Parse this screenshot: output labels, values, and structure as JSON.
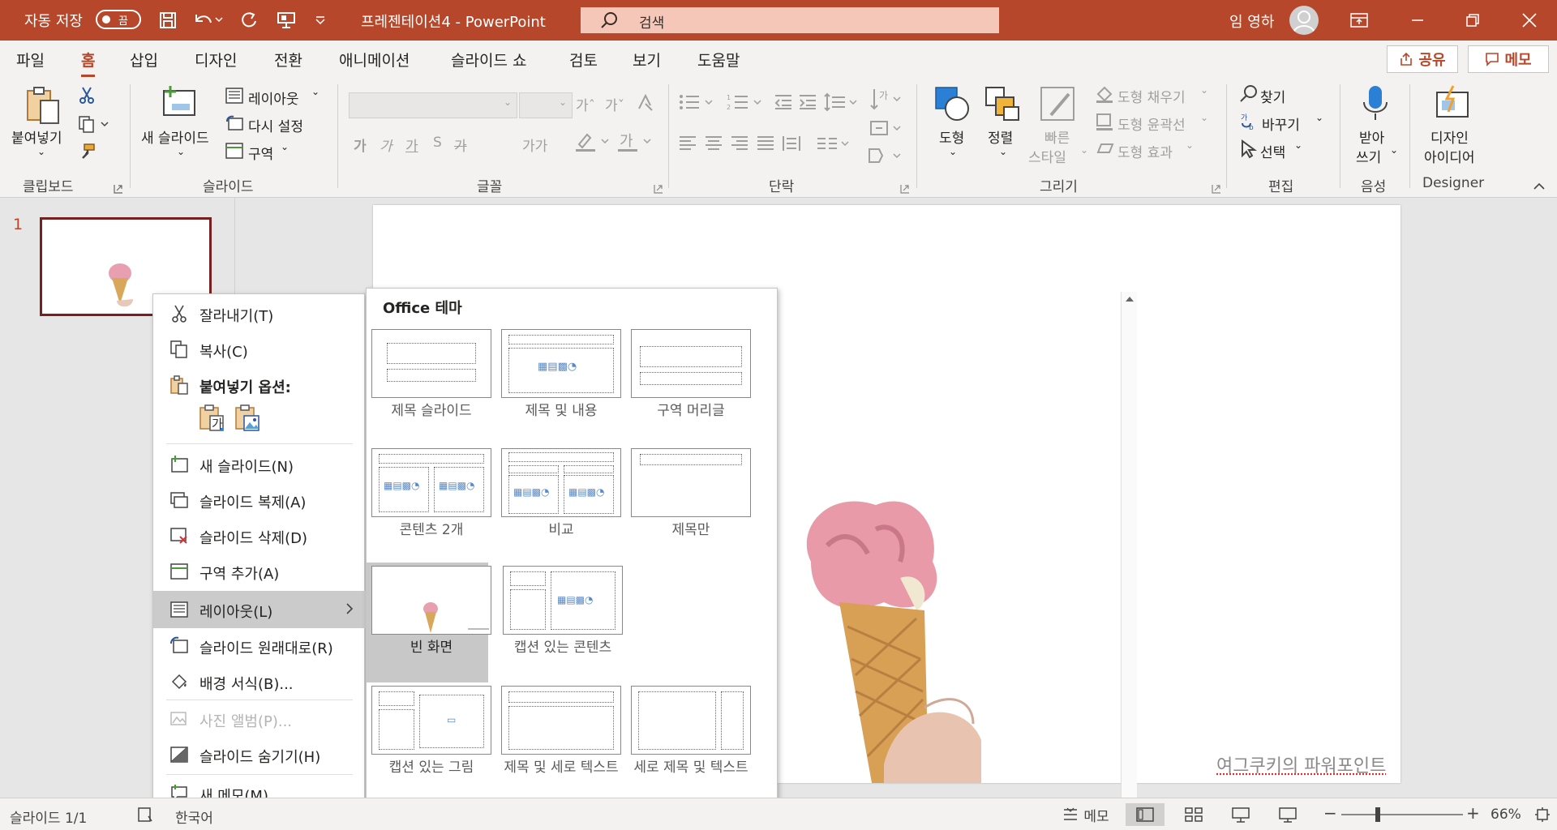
{
  "titlebar": {
    "autosave_label": "자동 저장",
    "autosave_state": "끔",
    "document_title": "프레젠테이션4  -  PowerPoint",
    "search_placeholder": "검색",
    "user_name": "임 영하",
    "bg_color": "#b7472a"
  },
  "tabs": [
    "파일",
    "홈",
    "삽입",
    "디자인",
    "전환",
    "애니메이션",
    "슬라이드 쇼",
    "검토",
    "보기",
    "도움말"
  ],
  "active_tab": "홈",
  "share_label": "공유",
  "memo_label": "메모",
  "ribbon": {
    "clipboard": {
      "paste": "붙여넣기",
      "group": "클립보드"
    },
    "slides": {
      "new_slide": "새 슬라이드",
      "layout": "레이아웃",
      "reset": "다시 설정",
      "section": "구역",
      "group": "슬라이드"
    },
    "font": {
      "group": "글꼴",
      "buttons": [
        "가",
        "가",
        "가",
        "S",
        "가",
        "가가"
      ]
    },
    "paragraph": {
      "group": "단락"
    },
    "drawing": {
      "shape": "도형",
      "arrange": "정렬",
      "quick_style_1": "빠른",
      "quick_style_2": "스타일",
      "fill": "도형 채우기",
      "outline": "도형 윤곽선",
      "effects": "도형 효과",
      "group": "그리기"
    },
    "editing": {
      "find": "찾기",
      "replace": "바꾸기",
      "select": "선택",
      "group": "편집"
    },
    "voice": {
      "dictate_1": "받아",
      "dictate_2": "쓰기",
      "group": "음성"
    },
    "designer": {
      "ideas_1": "디자인",
      "ideas_2": "아이디어",
      "group": "Designer"
    }
  },
  "thumbnail": {
    "number": "1"
  },
  "context_menu": [
    {
      "label": "잘라내기(T)",
      "icon": "scissors-icon"
    },
    {
      "label": "복사(C)",
      "icon": "copy-icon"
    },
    {
      "label": "붙여넣기 옵션:",
      "icon": "paste-icon"
    },
    {
      "label": "새 슬라이드(N)",
      "icon": "new-slide-icon"
    },
    {
      "label": "슬라이드 복제(A)",
      "icon": "duplicate-slide-icon"
    },
    {
      "label": "슬라이드 삭제(D)",
      "icon": "delete-slide-icon"
    },
    {
      "label": "구역 추가(A)",
      "icon": "add-section-icon"
    },
    {
      "label": "레이아웃(L)",
      "icon": "layout-icon"
    },
    {
      "label": "슬라이드 원래대로(R)",
      "icon": "reset-slide-icon"
    },
    {
      "label": "배경 서식(B)...",
      "icon": "format-background-icon"
    },
    {
      "label": "사진 앨범(P)...",
      "icon": "photo-album-icon"
    },
    {
      "label": "슬라이드 숨기기(H)",
      "icon": "hide-slide-icon"
    },
    {
      "label": "새 메모(M)",
      "icon": "new-comment-icon"
    }
  ],
  "paste_option_glyph": "가",
  "layout_gallery": {
    "title": "Office 테마",
    "items": [
      "제목 슬라이드",
      "제목 및 내용",
      "구역 머리글",
      "콘텐츠 2개",
      "비교",
      "제목만",
      "빈 화면",
      "캡션 있는 콘텐츠",
      "캡션 있는 그림",
      "제목 및 세로 텍스트",
      "세로 제목 및 텍스트"
    ],
    "selected": "빈 화면"
  },
  "slide": {
    "watermark": "여그쿠키의 파워포인트"
  },
  "status": {
    "slide_count": "슬라이드 1/1",
    "language": "한국어",
    "notes": "메모",
    "zoom": "66%"
  }
}
